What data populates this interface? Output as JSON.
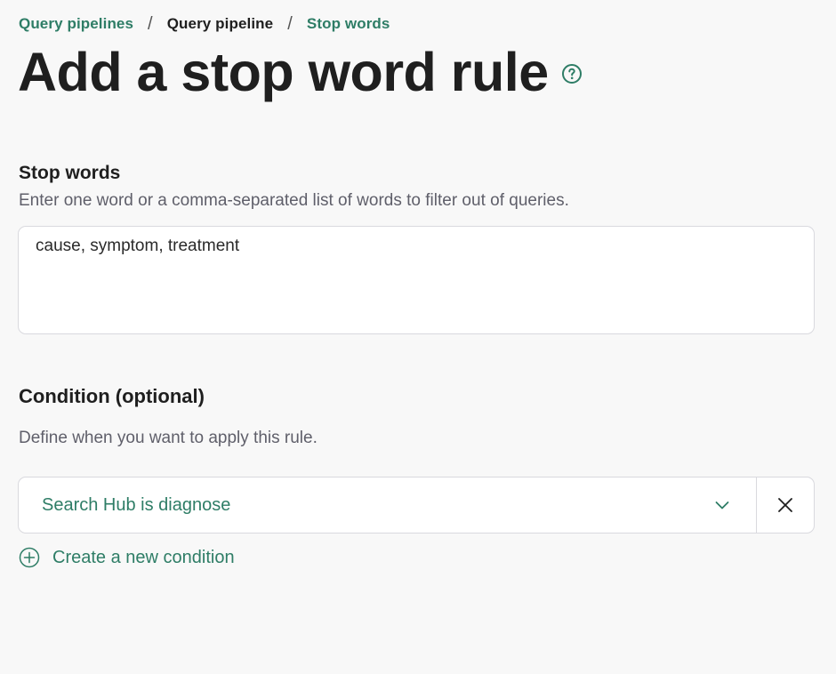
{
  "breadcrumb": {
    "items": [
      {
        "label": "Query pipelines"
      },
      {
        "label": "Query pipeline"
      },
      {
        "label": "Stop words"
      }
    ],
    "separator": "/"
  },
  "page": {
    "title": "Add a stop word rule",
    "help_icon": "question-circle-icon"
  },
  "stop_words": {
    "label": "Stop words",
    "help": "Enter one word or a comma-separated list of words to filter out of queries.",
    "value": "cause, symptom, treatment"
  },
  "condition": {
    "label": "Condition (optional)",
    "help": "Define when you want to apply this rule.",
    "selected": "Search Hub is diagnose",
    "create_label": "Create a new condition"
  },
  "colors": {
    "accent": "#2e7d66",
    "background": "#f8f8f8",
    "border": "#d9d9de",
    "muted_text": "#5f5f6a"
  }
}
